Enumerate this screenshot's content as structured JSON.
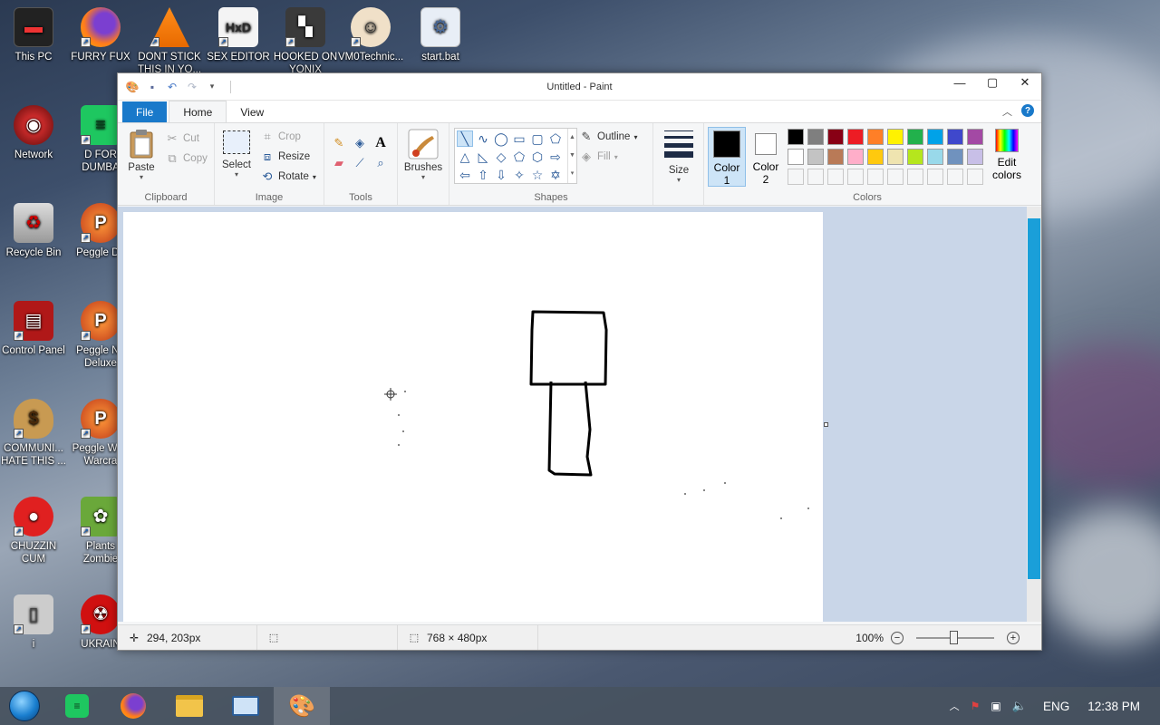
{
  "desktop": {
    "icons": [
      {
        "label": "This PC",
        "icon": "computer-icon"
      },
      {
        "label": "FURRY FUX",
        "icon": "firefox-icon"
      },
      {
        "label": "DONT STICK THIS IN YO...",
        "icon": "vlc-icon"
      },
      {
        "label": "SEX EDITOR",
        "icon": "hxd-icon"
      },
      {
        "label": "HOOKED ON YONIX",
        "icon": "app-icon"
      },
      {
        "label": "VM0Technic...",
        "icon": "doctor-icon"
      },
      {
        "label": "start.bat",
        "icon": "gear-file-icon"
      },
      {
        "label": "Network",
        "icon": "network-icon"
      },
      {
        "label": "D FOR DUMBA",
        "icon": "notes-icon"
      },
      {
        "label": "Recycle Bin",
        "icon": "recycle-bin-icon"
      },
      {
        "label": "Peggle De",
        "icon": "peggle-icon"
      },
      {
        "label": "Control Panel",
        "icon": "control-panel-icon"
      },
      {
        "label": "Peggle Na Deluxe",
        "icon": "peggle-icon"
      },
      {
        "label": "COMMUNI... HATE THIS ...",
        "icon": "money-bag-icon"
      },
      {
        "label": "Peggle W of Warcra",
        "icon": "peggle-icon"
      },
      {
        "label": "CHUZZIN CUM",
        "icon": "chuzzle-icon"
      },
      {
        "label": "Plants Zombie",
        "icon": "plants-icon"
      },
      {
        "label": "i",
        "icon": "file-icon"
      },
      {
        "label": "UKRAIN",
        "icon": "radiation-icon"
      }
    ]
  },
  "paint": {
    "title": "Untitled - Paint",
    "tabs": {
      "file": "File",
      "home": "Home",
      "view": "View"
    },
    "clipboard": {
      "paste": "Paste",
      "cut": "Cut",
      "copy": "Copy",
      "group": "Clipboard"
    },
    "image": {
      "select": "Select",
      "crop": "Crop",
      "resize": "Resize",
      "rotate": "Rotate",
      "group": "Image"
    },
    "tools": {
      "group": "Tools",
      "text_glyph": "A"
    },
    "brushes": {
      "label": "Brushes"
    },
    "shapes": {
      "outline": "Outline",
      "fill": "Fill",
      "group": "Shapes"
    },
    "size": {
      "label": "Size"
    },
    "colors": {
      "color1_label": "Color",
      "color1_num": "1",
      "color2_label": "Color",
      "color2_num": "2",
      "edit_label_1": "Edit",
      "edit_label_2": "colors",
      "group": "Colors",
      "color1_value": "#000000",
      "color2_value": "#ffffff",
      "palette_row1": [
        "#000000",
        "#7f7f7f",
        "#880015",
        "#ed1c24",
        "#ff7f27",
        "#fff200",
        "#22b14c",
        "#00a2e8",
        "#3f48cc",
        "#a349a4"
      ],
      "palette_row2": [
        "#ffffff",
        "#c3c3c3",
        "#b97a57",
        "#ffaec9",
        "#ffc90e",
        "#efe4b0",
        "#b5e61d",
        "#99d9ea",
        "#7092be",
        "#c8bfe7"
      ]
    },
    "status": {
      "cursor_pos": "294, 203px",
      "canvas_size": "768 × 480px",
      "zoom": "100%"
    }
  },
  "taskbar": {
    "language": "ENG",
    "time": "12:38 PM"
  }
}
